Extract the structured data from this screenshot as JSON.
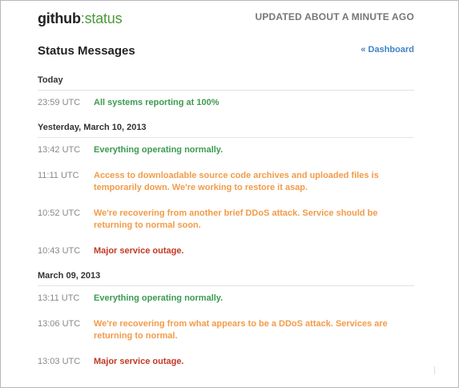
{
  "header": {
    "logo_main": "github",
    "logo_colon": ":",
    "logo_sub": "status",
    "updated": "UPDATED ABOUT A MINUTE AGO"
  },
  "page": {
    "title": "Status Messages",
    "dashboard_link": "« Dashboard"
  },
  "days": [
    {
      "label": "Today",
      "messages": [
        {
          "time": "23:59 UTC",
          "text": "All systems reporting at 100%",
          "status": "good"
        }
      ]
    },
    {
      "label": "Yesterday, March 10, 2013",
      "messages": [
        {
          "time": "13:42 UTC",
          "text": "Everything operating normally.",
          "status": "good"
        },
        {
          "time": "11:11 UTC",
          "text": "Access to downloadable source code archives and uploaded files is temporarily down. We're working to restore it asap.",
          "status": "minor"
        },
        {
          "time": "10:52 UTC",
          "text": "We're recovering from another brief DDoS attack. Service should be returning to normal soon.",
          "status": "minor"
        },
        {
          "time": "10:43 UTC",
          "text": "Major service outage.",
          "status": "major"
        }
      ]
    },
    {
      "label": "March 09, 2013",
      "messages": [
        {
          "time": "13:11 UTC",
          "text": "Everything operating normally.",
          "status": "good"
        },
        {
          "time": "13:06 UTC",
          "text": "We're recovering from what appears to be a DDoS attack. Services are returning to normal.",
          "status": "minor"
        },
        {
          "time": "13:03 UTC",
          "text": "Major service outage.",
          "status": "major"
        }
      ]
    }
  ],
  "colors": {
    "good": "#3c9a52",
    "minor": "#f29b48",
    "major": "#c23a25",
    "link": "#4183c4"
  }
}
